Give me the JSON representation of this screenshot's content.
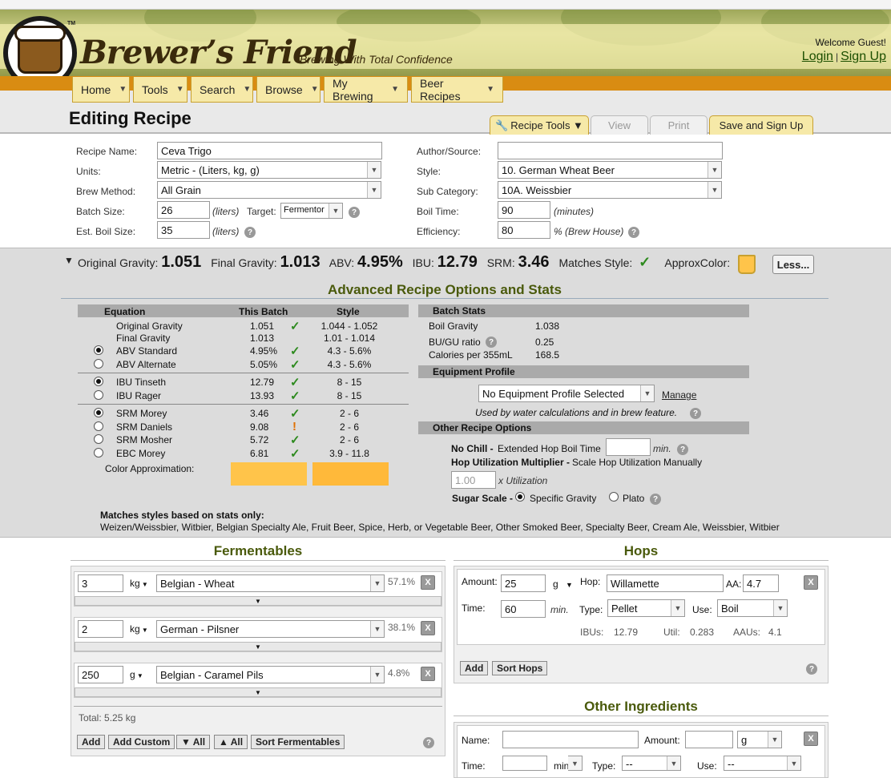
{
  "brand": {
    "name": "Brewer’s Friend",
    "tm": "TM",
    "tagline": "Brewing With Total Confidence"
  },
  "user": {
    "welcome": "Welcome Guest!",
    "login": "Login",
    "separator": "|",
    "signup": "Sign Up"
  },
  "nav": [
    "Home",
    "Tools",
    "Search",
    "Browse",
    "My Brewing",
    "Beer Recipes"
  ],
  "page_title": "Editing Recipe",
  "tabs": {
    "recipe_tools": "Recipe Tools ▼",
    "view": "View",
    "print": "Print",
    "save": "Save and Sign Up"
  },
  "form": {
    "recipe_name_label": "Recipe Name:",
    "recipe_name": "Ceva Trigo",
    "units_label": "Units:",
    "units": "Metric - (Liters, kg, g)",
    "brew_method_label": "Brew Method:",
    "brew_method": "All Grain",
    "batch_size_label": "Batch Size:",
    "batch_size": "26",
    "batch_unit": "(liters)",
    "target_label": "Target:",
    "target": "Fermentor",
    "boil_size_label": "Est. Boil Size:",
    "boil_size": "35",
    "boil_unit": "(liters)",
    "author_label": "Author/Source:",
    "author": "",
    "style_label": "Style:",
    "style": "10. German Wheat Beer",
    "subcat_label": "Sub Category:",
    "subcat": "10A. Weissbier",
    "boil_time_label": "Boil Time:",
    "boil_time": "90",
    "boil_time_unit": "(minutes)",
    "efficiency_label": "Efficiency:",
    "efficiency": "80",
    "efficiency_unit": "% (Brew House)"
  },
  "summary": {
    "og_label": "Original Gravity:",
    "og": "1.051",
    "fg_label": "Final Gravity:",
    "fg": "1.013",
    "abv_label": "ABV:",
    "abv": "4.95%",
    "ibu_label": "IBU:",
    "ibu": "12.79",
    "srm_label": "SRM:",
    "srm": "3.46",
    "matches_label": "Matches Style:",
    "color_label": "ApproxColor:",
    "less_button": "Less..."
  },
  "advanced": {
    "title": "Advanced Recipe Options and Stats",
    "headers": {
      "equation": "Equation",
      "batch": "This Batch",
      "style": "Style"
    },
    "rows": [
      {
        "name": "Original Gravity",
        "batch": "1.051",
        "style": "1.044 - 1.052",
        "mark": "check",
        "radio": "none"
      },
      {
        "name": "Final Gravity",
        "batch": "1.013",
        "style": "1.01 - 1.014",
        "mark": "",
        "radio": "none"
      },
      {
        "name": "ABV Standard",
        "batch": "4.95%",
        "style": "4.3 - 5.6%",
        "mark": "check",
        "radio": "on"
      },
      {
        "name": "ABV Alternate",
        "batch": "5.05%",
        "style": "4.3 - 5.6%",
        "mark": "check",
        "radio": "off"
      },
      {
        "name": "IBU Tinseth",
        "batch": "12.79",
        "style": "8 - 15",
        "mark": "check",
        "radio": "on"
      },
      {
        "name": "IBU Rager",
        "batch": "13.93",
        "style": "8 - 15",
        "mark": "check",
        "radio": "off"
      },
      {
        "name": "SRM Morey",
        "batch": "3.46",
        "style": "2 - 6",
        "mark": "check",
        "radio": "on"
      },
      {
        "name": "SRM Daniels",
        "batch": "9.08",
        "style": "2 - 6",
        "mark": "warn",
        "radio": "off"
      },
      {
        "name": "SRM Mosher",
        "batch": "5.72",
        "style": "2 - 6",
        "mark": "check",
        "radio": "off"
      },
      {
        "name": "EBC Morey",
        "batch": "6.81",
        "style": "3.9 - 11.8",
        "mark": "check",
        "radio": "off"
      }
    ],
    "color_approx_label": "Color Approximation:",
    "color_batch": "#ffc44a",
    "color_style": "#ffb93a",
    "batch_stats_header": "Batch Stats",
    "boil_gravity_label": "Boil Gravity",
    "boil_gravity": "1.038",
    "bugu_label": "BU/GU ratio",
    "bugu": "0.25",
    "calories_label": "Calories per 355mL",
    "calories": "168.5",
    "equipment_header": "Equipment Profile",
    "equipment": "No Equipment Profile Selected",
    "manage": "Manage",
    "equipment_note": "Used by water calculations and in brew feature.",
    "other_header": "Other Recipe Options",
    "no_chill": "No Chill -",
    "ext_hop": "Extended Hop Boil Time",
    "min_unit": "min.",
    "hop_util_label": "Hop Utilization Multiplier -",
    "hop_util_desc": "Scale Hop Utilization Manually",
    "hop_util_placeholder": "1.00",
    "x_util": "x Utilization",
    "sugar_scale": "Sugar Scale -",
    "sg": "Specific Gravity",
    "plato": "Plato",
    "matches_title": "Matches styles based on stats only:",
    "matches_list": "Weizen/Weissbier, Witbier, Belgian Specialty Ale, Fruit Beer, Spice, Herb, or Vegetable Beer, Other Smoked Beer, Specialty Beer, Cream Ale, Weissbier, Witbier"
  },
  "fermentables": {
    "title": "Fermentables",
    "items": [
      {
        "amount": "3",
        "unit": "kg",
        "name": "Belgian - Wheat",
        "pct": "57.1%"
      },
      {
        "amount": "2",
        "unit": "kg",
        "name": "German - Pilsner",
        "pct": "38.1%"
      },
      {
        "amount": "250",
        "unit": "g",
        "name": "Belgian - Caramel Pils",
        "pct": "4.8%"
      }
    ],
    "total": "Total: 5.25 kg",
    "buttons": {
      "add": "Add",
      "add_custom": "Add Custom",
      "down_all": "▼ All",
      "up_all": "▲ All",
      "sort": "Sort Fermentables"
    }
  },
  "hops": {
    "title": "Hops",
    "amount_label": "Amount:",
    "amount": "25",
    "unit": "g",
    "hop_label": "Hop:",
    "hop": "Willamette",
    "aa_label": "AA:",
    "aa": "4.7",
    "time_label": "Time:",
    "time": "60",
    "time_unit": "min.",
    "type_label": "Type:",
    "type": "Pellet",
    "use_label": "Use:",
    "use": "Boil",
    "ibus_label": "IBUs:",
    "ibus": "12.79",
    "util_label": "Util:",
    "util": "0.283",
    "aaus_label": "AAUs:",
    "aaus": "4.1",
    "buttons": {
      "add": "Add",
      "sort": "Sort Hops"
    }
  },
  "other": {
    "title": "Other Ingredients",
    "name_label": "Name:",
    "amount_label": "Amount:",
    "unit": "g",
    "time_label": "Time:",
    "time_unit": "min",
    "type_label": "Type:",
    "type": "--",
    "use_label": "Use:",
    "use": "--"
  },
  "colors": {
    "accent_green": "#4a5a0c",
    "nav_orange": "#d98c12",
    "check_green": "#2d8a1e",
    "warn_orange": "#e07000"
  }
}
